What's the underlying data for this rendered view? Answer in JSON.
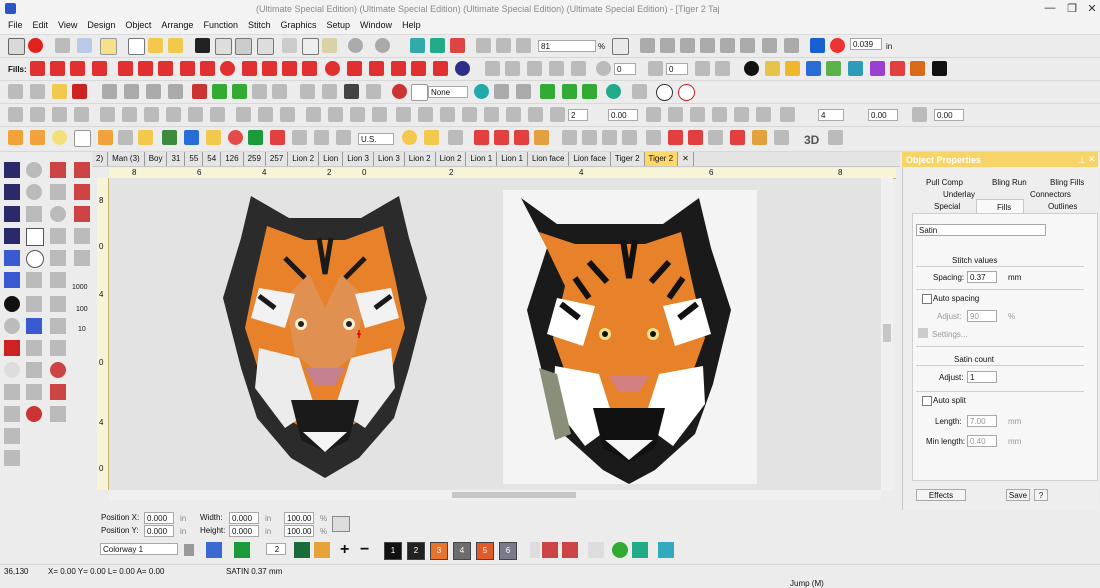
{
  "window": {
    "title": "(Ultimate Special Edition) (Ultimate Special Edition) (Ultimate Special Edition) (Ultimate Special Edition) - [Tiger 2      Taj",
    "min_glyph": "—",
    "restore_glyph": "❐",
    "close_glyph": "✕"
  },
  "menu": [
    "File",
    "Edit",
    "View",
    "Design",
    "Object",
    "Arrange",
    "Function",
    "Stitch",
    "Graphics",
    "Setup",
    "Window",
    "Help"
  ],
  "toolbar": {
    "zoom_value": "81",
    "zoom_unit": "%",
    "spacing_value": "0.039",
    "spacing_unit": "in",
    "fills_label": "Fills:",
    "angle_value": "0",
    "none_label": "None",
    "font_label": "U.S.",
    "spin_value_a": "2",
    "spin_value_b": "0.00",
    "spin_value_c": "4",
    "spin_value_d": "0.00",
    "three_d_label": "3D"
  },
  "doc_tabs": [
    "2)",
    "Man (3)",
    "Boy",
    "31",
    "55",
    "54",
    "126",
    "259",
    "257",
    "Lion 2",
    "Lion",
    "Lion 3",
    "Lion 3",
    "Lion 2",
    "Lion 2",
    "Lion 1",
    "Lion 1",
    "Lion face",
    "Lion face",
    "Tiger 2",
    "Tiger 2"
  ],
  "active_tab_index": 20,
  "ruler_marks": [
    "8",
    "6",
    "4",
    "2",
    "0",
    "2",
    "4",
    "6",
    "8"
  ],
  "left_ruler_marks": [
    "8",
    "0",
    "4",
    "0",
    "4",
    "0"
  ],
  "tool_numbers": [
    "1000",
    "100",
    "10"
  ],
  "properties": {
    "title": "Object Properties",
    "tabs_row1": [
      "Pull Comp",
      "Bling Run",
      "Bling Fills"
    ],
    "tabs_row2": [
      "Underlay",
      "Connectors"
    ],
    "tabs_row3": [
      "Special",
      "Fills",
      "Outlines"
    ],
    "fill_type": "Satin",
    "stitch_values_label": "Stitch values",
    "spacing_label": "Spacing:",
    "spacing_value": "0.37",
    "spacing_unit": "mm",
    "auto_spacing_label": "Auto spacing",
    "adjust_label": "Adjust:",
    "adjust_value": "90",
    "adjust_unit": "%",
    "settings_label": "Settings...",
    "satin_count_label": "Satin count",
    "satin_adjust_label": "Adjust:",
    "satin_adjust_value": "1",
    "auto_split_label": "Auto split",
    "length_label": "Length:",
    "length_value": "7.00",
    "length_unit": "mm",
    "min_length_label": "Min length:",
    "min_length_value": "0.40",
    "min_length_unit": "mm",
    "effects_label": "Effects",
    "save_label": "Save",
    "help_label": "?"
  },
  "position": {
    "x_label": "Position X:",
    "x_value": "0.000",
    "x_unit": "in",
    "y_label": "Position Y:",
    "y_value": "0.000",
    "y_unit": "in",
    "w_label": "Width:",
    "w_value": "0.000",
    "w_unit": "in",
    "h_label": "Height:",
    "h_value": "0.000",
    "h_unit": "in",
    "wp_value": "100.00",
    "hp_value": "100.00",
    "pct_unit": "%"
  },
  "colorway": {
    "label": "Colorway 1",
    "count": "2",
    "swatches": [
      {
        "label": "1",
        "color": "#111111"
      },
      {
        "label": "2",
        "color": "#222222"
      },
      {
        "label": "3",
        "color": "#e8732a"
      },
      {
        "label": "4",
        "color": "#6d6d6d"
      },
      {
        "label": "5",
        "color": "#e05a2a"
      },
      {
        "label": "6",
        "color": "#7a7a8a"
      }
    ]
  },
  "status": {
    "coords": "36,130",
    "readout": "X=    0.00 Y=    0.00 L=    0.00 A=    0.00",
    "stitch": "SATIN  0.37 mm",
    "mode": "Jump (M)"
  },
  "colors": {
    "accent": "#f6d468",
    "tiger_orange": "#e8822a",
    "tiger_dark": "#1a1a1a",
    "canvas": "#e3e3e3"
  }
}
